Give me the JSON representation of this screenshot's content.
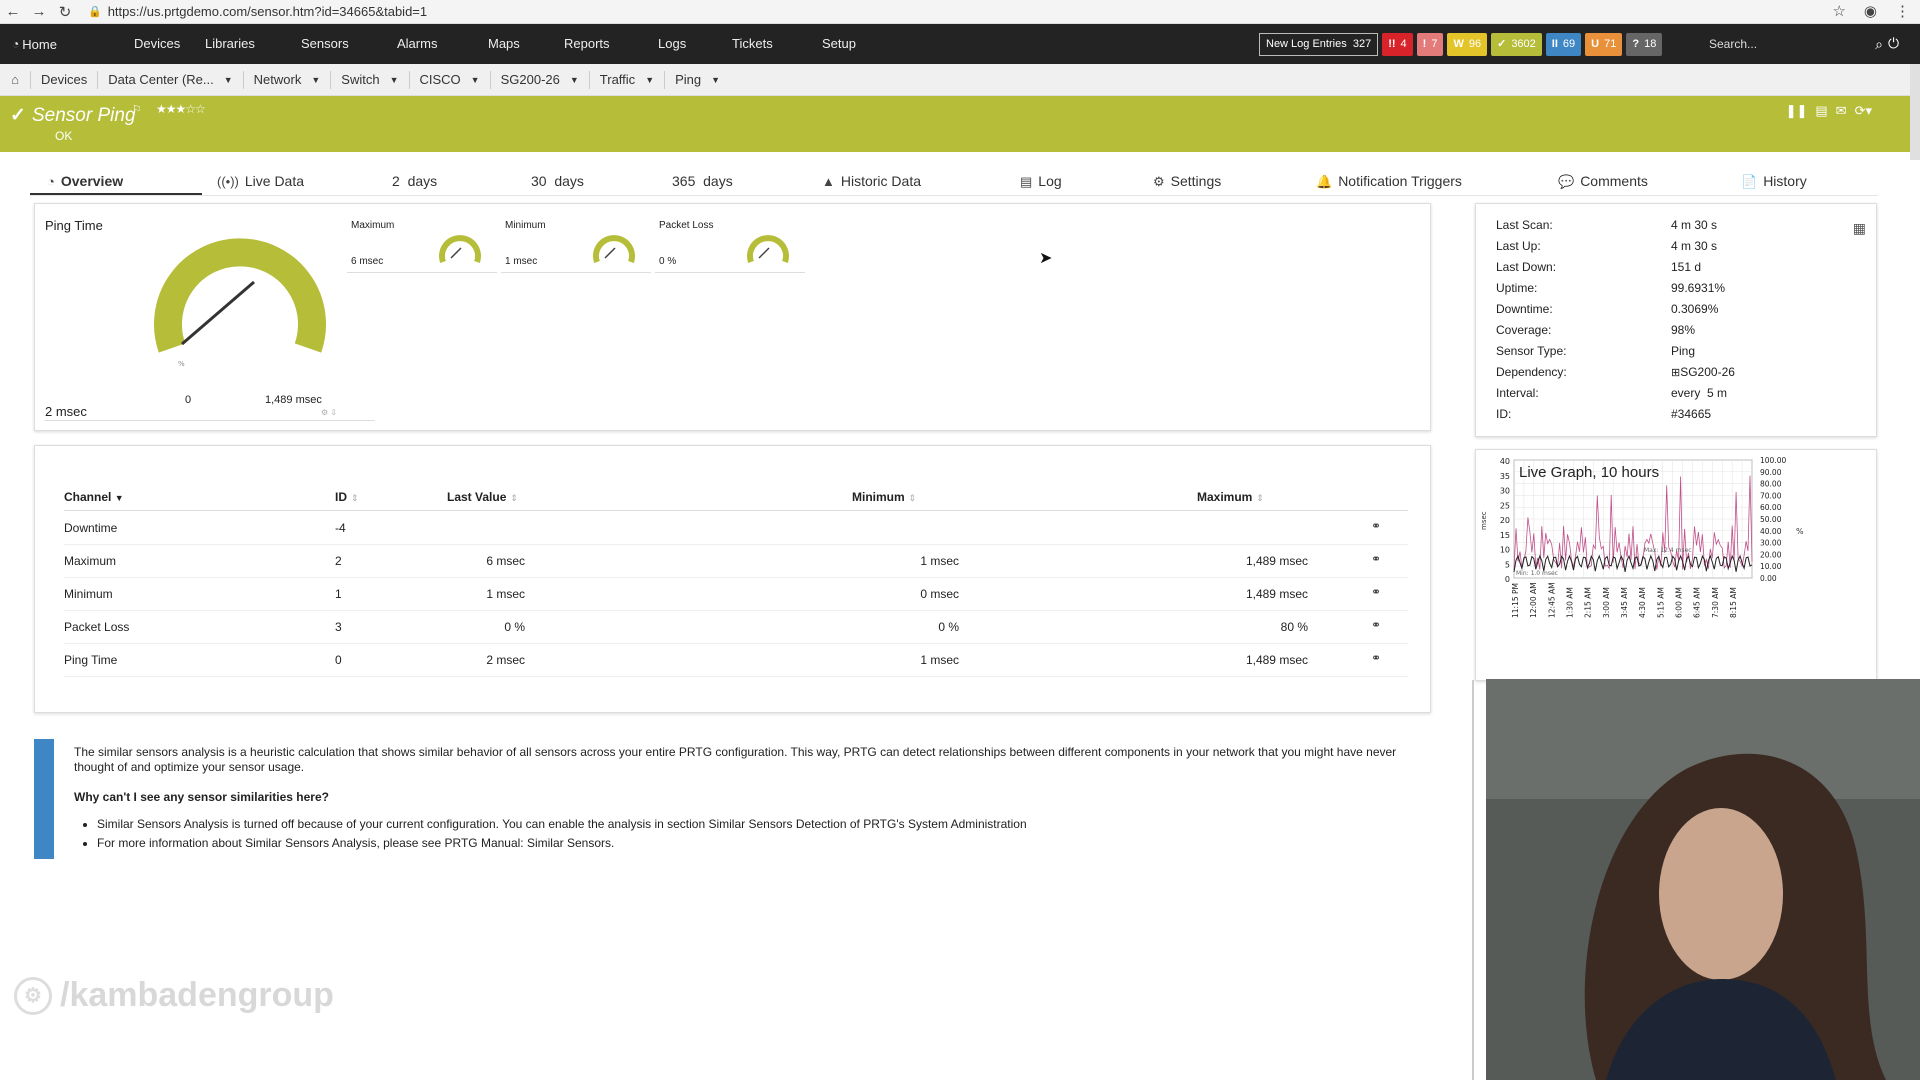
{
  "browser": {
    "url": "https://us.prtgdemo.com/sensor.htm?id=34665&tabid=1"
  },
  "nav": {
    "home": "Home",
    "items": [
      "Devices",
      "Libraries",
      "Sensors",
      "Alarms",
      "Maps",
      "Reports",
      "Logs",
      "Tickets",
      "Setup"
    ],
    "log_entries_label": "New Log Entries",
    "log_entries_count": "327",
    "badges": [
      {
        "label": "4",
        "glyph": "!!",
        "color": "#d9232a"
      },
      {
        "label": "7",
        "glyph": "!",
        "color": "#e37b7b"
      },
      {
        "label": "96",
        "glyph": "W",
        "color": "#e3c52a"
      },
      {
        "label": "3602",
        "glyph": "✓",
        "color": "#b5bd39"
      },
      {
        "label": "69",
        "glyph": "II",
        "color": "#3f86c5"
      },
      {
        "label": "71",
        "glyph": "U",
        "color": "#e8913a"
      },
      {
        "label": "18",
        "glyph": "?",
        "color": "#666666"
      }
    ],
    "search_placeholder": "Search..."
  },
  "breadcrumb": [
    "Devices",
    "Data Center (Re...",
    "Network",
    "Switch",
    "CISCO",
    "SG200-26",
    "Traffic",
    "Ping"
  ],
  "sensor": {
    "title": "Sensor Ping",
    "status": "OK",
    "stars": "★★★☆☆"
  },
  "tabs": [
    {
      "label": "Overview",
      "icon": "gauge-icon"
    },
    {
      "label": "Live Data",
      "icon": "broadcast-icon"
    },
    {
      "label": "2  days",
      "icon": ""
    },
    {
      "label": "30  days",
      "icon": ""
    },
    {
      "label": "365  days",
      "icon": ""
    },
    {
      "label": "Historic Data",
      "icon": "chart-icon"
    },
    {
      "label": "Log",
      "icon": "log-icon"
    },
    {
      "label": "Settings",
      "icon": "gear-icon"
    },
    {
      "label": "Notification Triggers",
      "icon": "bell-icon"
    },
    {
      "label": "Comments",
      "icon": "comment-icon"
    },
    {
      "label": "History",
      "icon": "history-icon"
    }
  ],
  "gauges": {
    "main": {
      "label": "Ping Time",
      "value": "2 msec",
      "min": "0",
      "max": "1,489 msec"
    },
    "mini": [
      {
        "label": "Maximum",
        "value": "6 msec"
      },
      {
        "label": "Minimum",
        "value": "1 msec"
      },
      {
        "label": "Packet Loss",
        "value": "0 %"
      }
    ]
  },
  "info": [
    {
      "key": "Last Scan:",
      "value": "4 m 30 s"
    },
    {
      "key": "Last Up:",
      "value": "4 m 30 s"
    },
    {
      "key": "Last Down:",
      "value": "151 d"
    },
    {
      "key": "Uptime:",
      "value": "99.6931%"
    },
    {
      "key": "Downtime:",
      "value": "0.3069%"
    },
    {
      "key": "Coverage:",
      "value": "98%"
    },
    {
      "key": "Sensor Type:",
      "value": "Ping"
    },
    {
      "key": "Dependency:",
      "value": "SG200-26"
    },
    {
      "key": "Interval:",
      "value": "every  5 m"
    },
    {
      "key": "ID:",
      "value": "#34665"
    }
  ],
  "table": {
    "headers": [
      "Channel",
      "ID",
      "Last Value",
      "Minimum",
      "Maximum"
    ],
    "rows": [
      {
        "channel": "Downtime",
        "id": "-4",
        "last": "",
        "min": "",
        "max": ""
      },
      {
        "channel": "Maximum",
        "id": "2",
        "last": "6 msec",
        "min": "1 msec",
        "max": "1,489 msec"
      },
      {
        "channel": "Minimum",
        "id": "1",
        "last": "1 msec",
        "min": "0 msec",
        "max": "1,489 msec"
      },
      {
        "channel": "Packet Loss",
        "id": "3",
        "last": "0 %",
        "min": "0 %",
        "max": "80 %"
      },
      {
        "channel": "Ping Time",
        "id": "0",
        "last": "2 msec",
        "min": "1 msec",
        "max": "1,489 msec"
      }
    ]
  },
  "live_graph": {
    "title": "Live Graph, 10 hours",
    "left_ticks": [
      "40",
      "35",
      "30",
      "25",
      "20",
      "15",
      "10",
      "5",
      "0"
    ],
    "right_ticks": [
      "100.00",
      "90.00",
      "80.00",
      "70.00",
      "60.00",
      "50.00",
      "40.00",
      "30.00",
      "20.00",
      "10.00",
      "0.00"
    ],
    "x_ticks": [
      "11:15 PM",
      "12:00 AM",
      "12:45 AM",
      "1:30 AM",
      "2:15 AM",
      "3:00 AM",
      "3:45 AM",
      "4:30 AM",
      "5:15 AM",
      "6:00 AM",
      "6:45 AM",
      "7:30 AM",
      "8:15 AM"
    ],
    "left_unit": "msec",
    "right_unit": "%",
    "max_note": "Max: 12.4 msec",
    "min_note": "Min: 1.0 msec"
  },
  "notice": {
    "text": "The similar sensors analysis is a heuristic calculation that shows similar behavior of all sensors across your entire PRTG configuration. This way, PRTG can detect relationships between different components in your network that you might have never thought of and optimize your sensor usage.",
    "question": "Why can't I see any sensor similarities here?",
    "bullets": [
      "Similar Sensors Analysis is turned off because of your current configuration. You can enable the analysis in section Similar Sensors Detection of PRTG's System Administration",
      "For more information about Similar Sensors Analysis, please see PRTG Manual: Similar Sensors."
    ]
  },
  "watermark": "/kambadengroup"
}
